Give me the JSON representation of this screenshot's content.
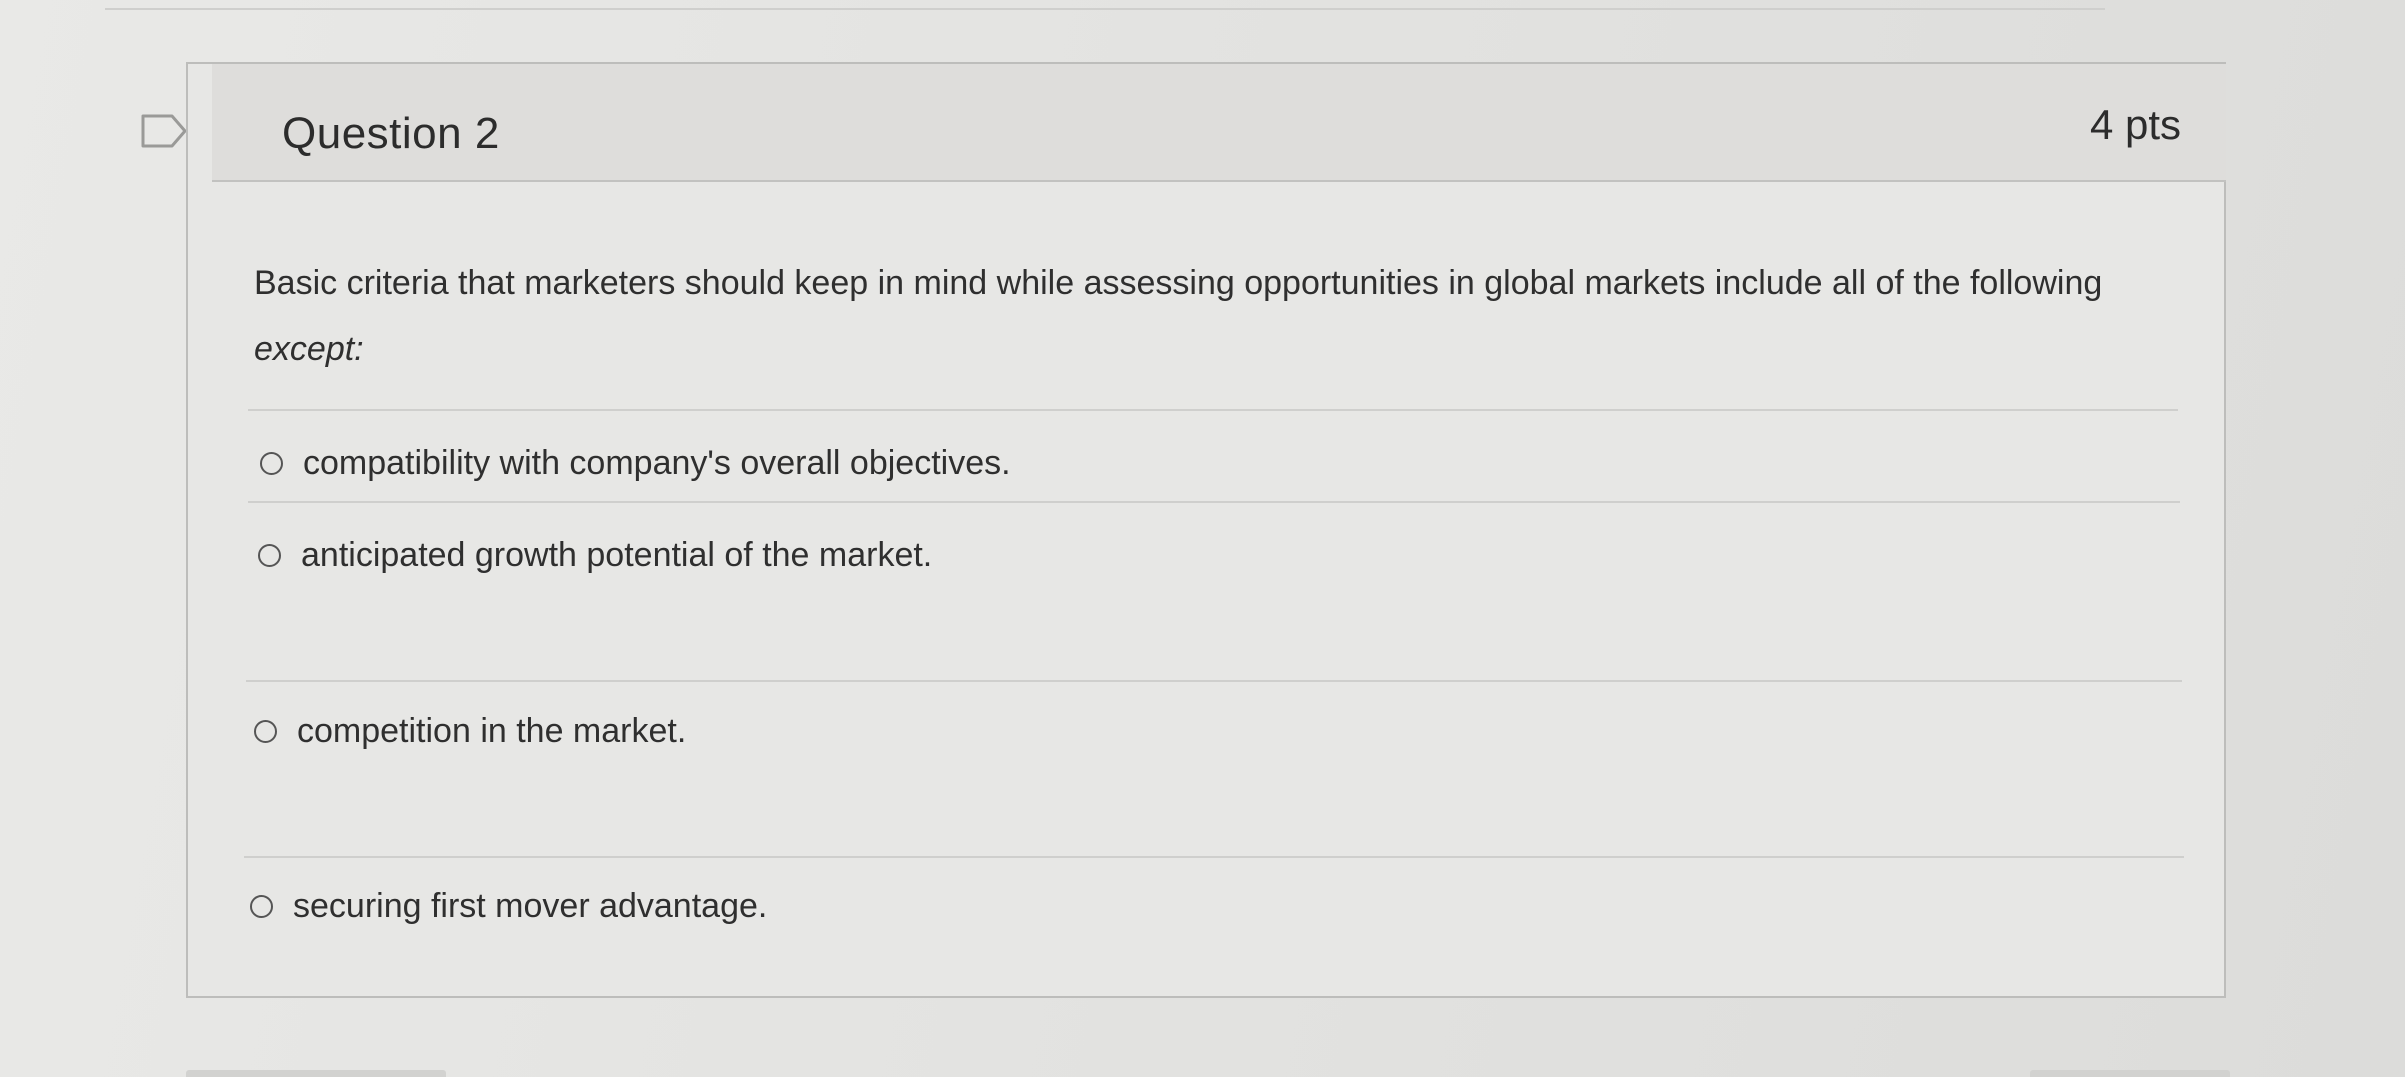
{
  "question": {
    "title": "Question 2",
    "points": "4 pts",
    "prompt": "Basic criteria that marketers should keep in mind while assessing opportunities in global markets include all of the following",
    "prompt_emphasis": "except:",
    "answers": [
      {
        "label": "compatibility with company's overall objectives."
      },
      {
        "label": "anticipated growth potential of the market."
      },
      {
        "label": "competition in the market."
      },
      {
        "label": "securing first mover advantage."
      }
    ]
  }
}
